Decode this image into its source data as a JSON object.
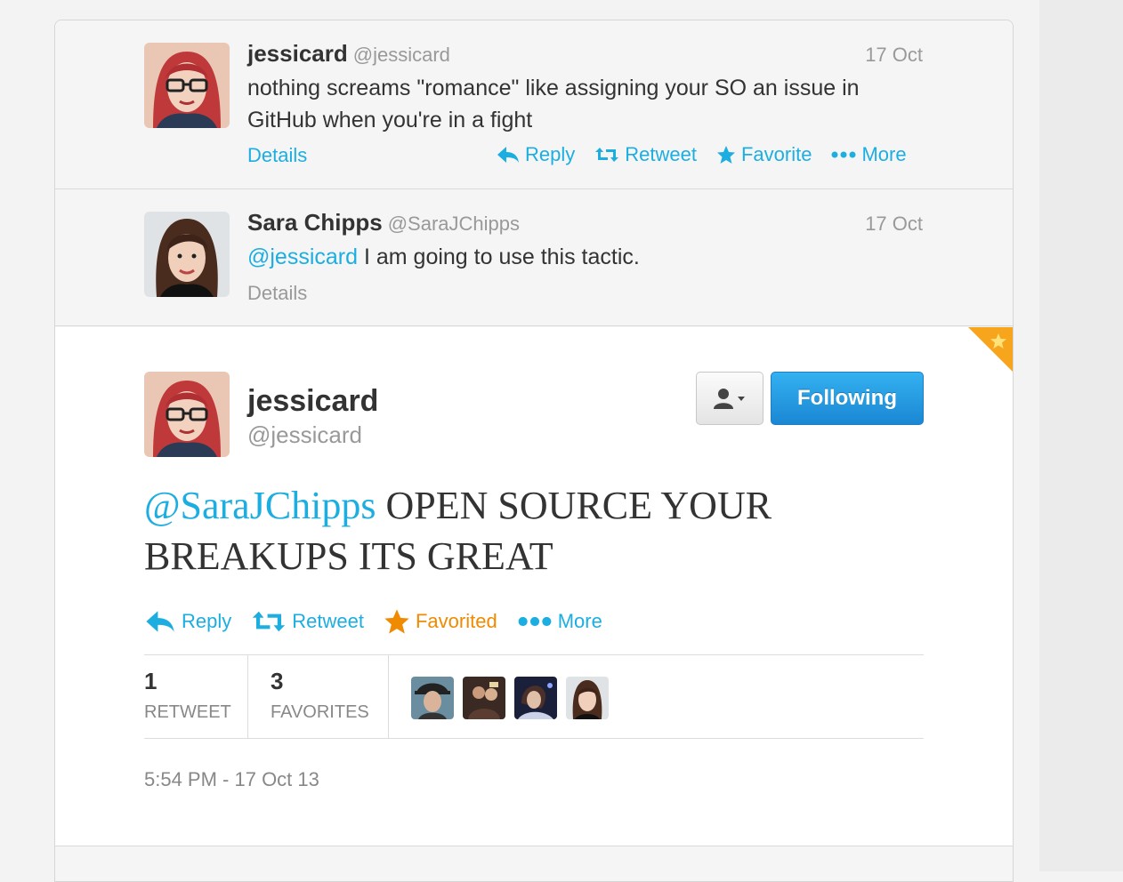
{
  "tweets": [
    {
      "fullname": "jessicard",
      "screenname": "@jessicard",
      "time": "17 Oct",
      "text": "nothing screams \"romance\" like assigning your SO an issue in GitHub when you're in a fight",
      "details_label": "Details",
      "actions": {
        "reply": "Reply",
        "retweet": "Retweet",
        "favorite": "Favorite",
        "more": "More"
      }
    },
    {
      "fullname": "Sara Chipps",
      "screenname": "@SaraJChipps",
      "time": "17 Oct",
      "mention": "@jessicard",
      "text": " I am going to use this tactic.",
      "details_label": "Details"
    }
  ],
  "main_tweet": {
    "fullname": "jessicard",
    "screenname": "@jessicard",
    "follow_label": "Following",
    "mention": "@SaraJChipps",
    "text": " OPEN SOURCE YOUR BREAKUPS ITS GREAT",
    "actions": {
      "reply": "Reply",
      "retweet": "Retweet",
      "favorited": "Favorited",
      "more": "More"
    },
    "stats": {
      "retweets": {
        "count": "1",
        "label": "RETWEET"
      },
      "favorites": {
        "count": "3",
        "label": "FAVORITES"
      }
    },
    "timestamp": "5:54 PM - 17 Oct 13"
  },
  "colors": {
    "link": "#1daee1",
    "favorited": "#f08a00",
    "follow_button": "#1b87d4"
  },
  "icons": [
    "reply-icon",
    "retweet-icon",
    "star-icon",
    "more-dots-icon",
    "user-dropdown-icon",
    "favorite-corner-badge-icon"
  ]
}
